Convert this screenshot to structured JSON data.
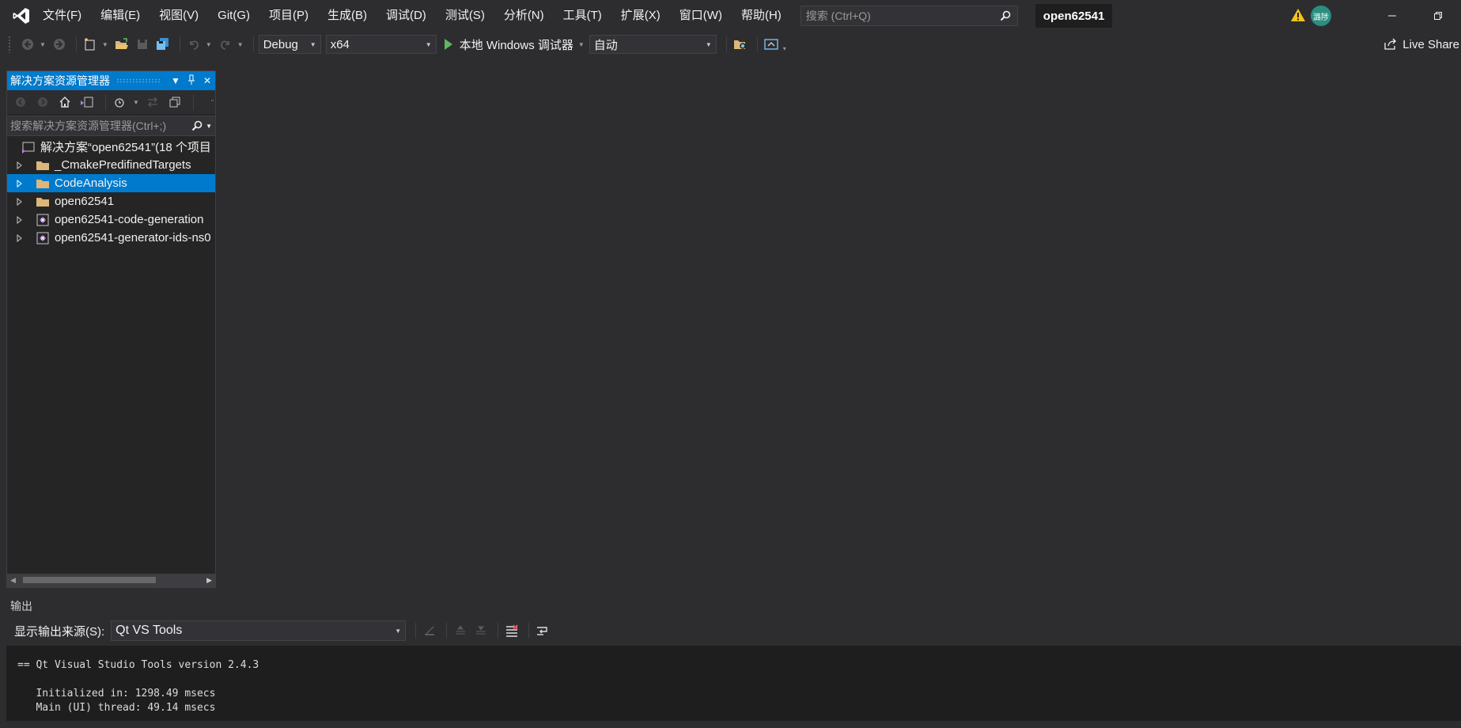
{
  "menu": {
    "items": [
      {
        "label": "文件(F)"
      },
      {
        "label": "编辑(E)"
      },
      {
        "label": "视图(V)"
      },
      {
        "label": "Git(G)"
      },
      {
        "label": "项目(P)"
      },
      {
        "label": "生成(B)"
      },
      {
        "label": "调试(D)"
      },
      {
        "label": "测试(S)"
      },
      {
        "label": "分析(N)"
      },
      {
        "label": "工具(T)"
      },
      {
        "label": "扩展(X)"
      },
      {
        "label": "窗口(W)"
      },
      {
        "label": "帮助(H)"
      }
    ],
    "search_placeholder": "搜索 (Ctrl+Q)",
    "solution_name": "open62541",
    "avatar_text": "潞陟"
  },
  "toolbar": {
    "configuration": "Debug",
    "platform": "x64",
    "run_label": "本地 Windows 调试器",
    "debug_target": "自动",
    "live_share": "Live Share"
  },
  "solution_explorer": {
    "title": "解决方案资源管理器",
    "search_placeholder": "搜索解决方案资源管理器(Ctrl+;)",
    "root_label": "解决方案“open62541”(18 个项目",
    "items": [
      {
        "label": "_CmakePredifinedTargets",
        "type": "folder"
      },
      {
        "label": "CodeAnalysis",
        "type": "folder"
      },
      {
        "label": "open62541",
        "type": "folder"
      },
      {
        "label": "open62541-code-generation",
        "type": "project"
      },
      {
        "label": "open62541-generator-ids-ns0",
        "type": "project"
      }
    ],
    "selected_index": 1
  },
  "output": {
    "title": "输出",
    "source_label": "显示输出来源(S):",
    "source_value": "Qt VS Tools",
    "lines": [
      "== Qt Visual Studio Tools version 2.4.3",
      "",
      "   Initialized in: 1298.49 msecs",
      "   Main (UI) thread: 49.14 msecs"
    ]
  },
  "colors": {
    "accent": "#007acc",
    "background": "#2d2d30",
    "panel": "#252526",
    "run_green": "#5fb85f",
    "vs_purple": "#b180d7"
  }
}
